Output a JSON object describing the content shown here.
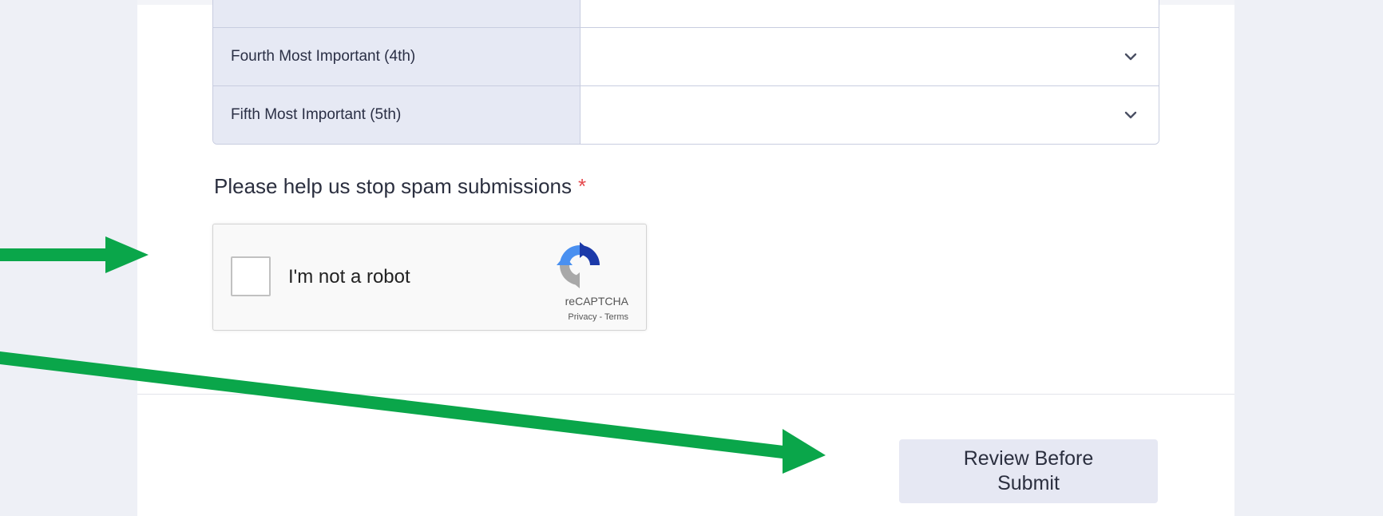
{
  "ranking": {
    "rows": [
      {
        "label": "",
        "value": ""
      },
      {
        "label": "Fourth Most Important (4th)",
        "value": ""
      },
      {
        "label": "Fifth Most Important (5th)",
        "value": ""
      }
    ]
  },
  "captcha": {
    "question": "Please help us stop spam submissions",
    "required_mark": "*",
    "checkbox_label": "I'm not a robot",
    "brand": "reCAPTCHA",
    "privacy": "Privacy",
    "separator": " - ",
    "terms": "Terms"
  },
  "actions": {
    "review_label": "Review Before Submit"
  },
  "colors": {
    "accent_arrow": "#0aa64a",
    "required": "#e5484d",
    "label_bg": "#e6e9f4",
    "button_bg": "#e6e8f3"
  },
  "icons": {
    "dropdown": "chevron-down-icon",
    "recaptcha": "recaptcha-logo-icon"
  }
}
